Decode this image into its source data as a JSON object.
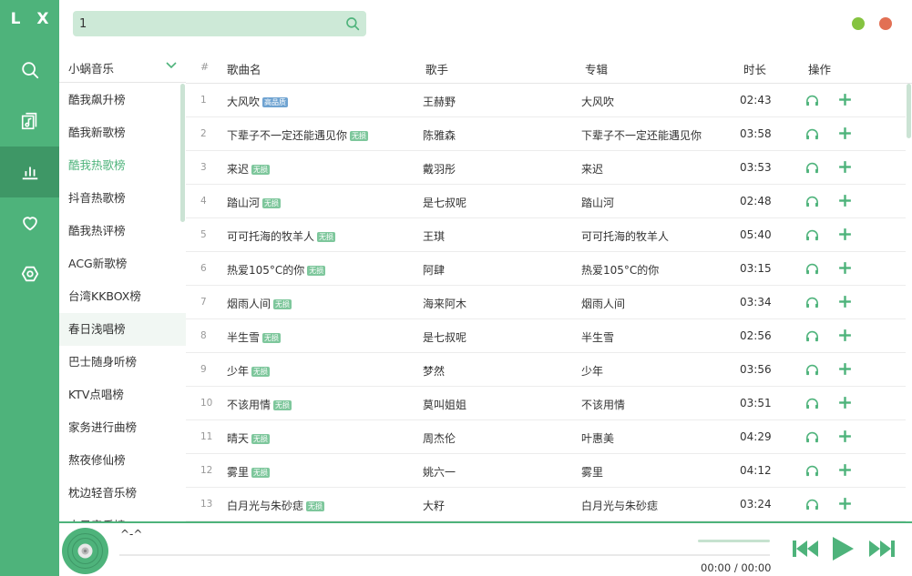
{
  "app": {
    "logo": "L X"
  },
  "colors": {
    "accent": "#4eb37b",
    "accent_dark": "#3e9766",
    "min_dot": "#85c340",
    "close_dot": "#e27054",
    "badge_free": "#7ec79c",
    "badge_hq": "#6fa3d1"
  },
  "nav": [
    {
      "name": "nav-search",
      "icon": "search-icon"
    },
    {
      "name": "nav-songlist",
      "icon": "music-file-icon"
    },
    {
      "name": "nav-leaderboard",
      "icon": "bar-chart-icon",
      "active": true
    },
    {
      "name": "nav-favorites",
      "icon": "heart-icon"
    },
    {
      "name": "nav-settings",
      "icon": "settings-icon"
    }
  ],
  "search": {
    "value": "1",
    "placeholder": ""
  },
  "board": {
    "source": "小蜗音乐",
    "items": [
      "酷我飙升榜",
      "酷我新歌榜",
      "酷我热歌榜",
      "抖音热歌榜",
      "酷我热评榜",
      "ACG新歌榜",
      "台湾KKBOX榜",
      "春日浅唱榜",
      "巴士随身听榜",
      "KTV点唱榜",
      "家务进行曲榜",
      "熬夜修仙榜",
      "枕边轻音乐榜",
      "古风音乐榜"
    ],
    "active_index": 2,
    "hover_index": 7
  },
  "table": {
    "headers": {
      "num": "#",
      "name": "歌曲名",
      "singer": "歌手",
      "album": "专辑",
      "duration": "时长",
      "action": "操作"
    },
    "rows": [
      {
        "num": "1",
        "name": "大风吹",
        "badge": "高品质",
        "badge_type": "hq",
        "singer": "王赫野",
        "album": "大风吹",
        "duration": "02:43"
      },
      {
        "num": "2",
        "name": "下辈子不一定还能遇见你",
        "badge": "无损",
        "badge_type": "free",
        "singer": "陈雅森",
        "album": "下辈子不一定还能遇见你",
        "duration": "03:58"
      },
      {
        "num": "3",
        "name": "来迟",
        "badge": "无损",
        "badge_type": "free",
        "singer": "戴羽彤",
        "album": "来迟",
        "duration": "03:53"
      },
      {
        "num": "4",
        "name": "踏山河",
        "badge": "无损",
        "badge_type": "free",
        "singer": "是七叔呢",
        "album": "踏山河",
        "duration": "02:48"
      },
      {
        "num": "5",
        "name": "可可托海的牧羊人",
        "badge": "无损",
        "badge_type": "free",
        "singer": "王琪",
        "album": "可可托海的牧羊人",
        "duration": "05:40"
      },
      {
        "num": "6",
        "name": "热爱105°C的你",
        "badge": "无损",
        "badge_type": "free",
        "singer": "阿肆",
        "album": "热爱105°C的你",
        "duration": "03:15"
      },
      {
        "num": "7",
        "name": "烟雨人间",
        "badge": "无损",
        "badge_type": "free",
        "singer": "海来阿木",
        "album": "烟雨人间",
        "duration": "03:34"
      },
      {
        "num": "8",
        "name": "半生雪",
        "badge": "无损",
        "badge_type": "free",
        "singer": "是七叔呢",
        "album": "半生雪",
        "duration": "02:56"
      },
      {
        "num": "9",
        "name": "少年",
        "badge": "无损",
        "badge_type": "free",
        "singer": "梦然",
        "album": "少年",
        "duration": "03:56"
      },
      {
        "num": "10",
        "name": "不该用情",
        "badge": "无损",
        "badge_type": "free",
        "singer": "莫叫姐姐",
        "album": "不该用情",
        "duration": "03:51"
      },
      {
        "num": "11",
        "name": "晴天",
        "badge": "无损",
        "badge_type": "free",
        "singer": "周杰伦",
        "album": "叶惠美",
        "duration": "04:29"
      },
      {
        "num": "12",
        "name": "雾里",
        "badge": "无损",
        "badge_type": "free",
        "singer": "姚六一",
        "album": "雾里",
        "duration": "04:12"
      },
      {
        "num": "13",
        "name": "白月光与朱砂痣",
        "badge": "无损",
        "badge_type": "free",
        "singer": "大籽",
        "album": "白月光与朱砂痣",
        "duration": "03:24"
      }
    ]
  },
  "player": {
    "now_playing": "^-^",
    "time_current": "00:00",
    "time_sep": "/",
    "time_total": "00:00",
    "progress": 0
  }
}
